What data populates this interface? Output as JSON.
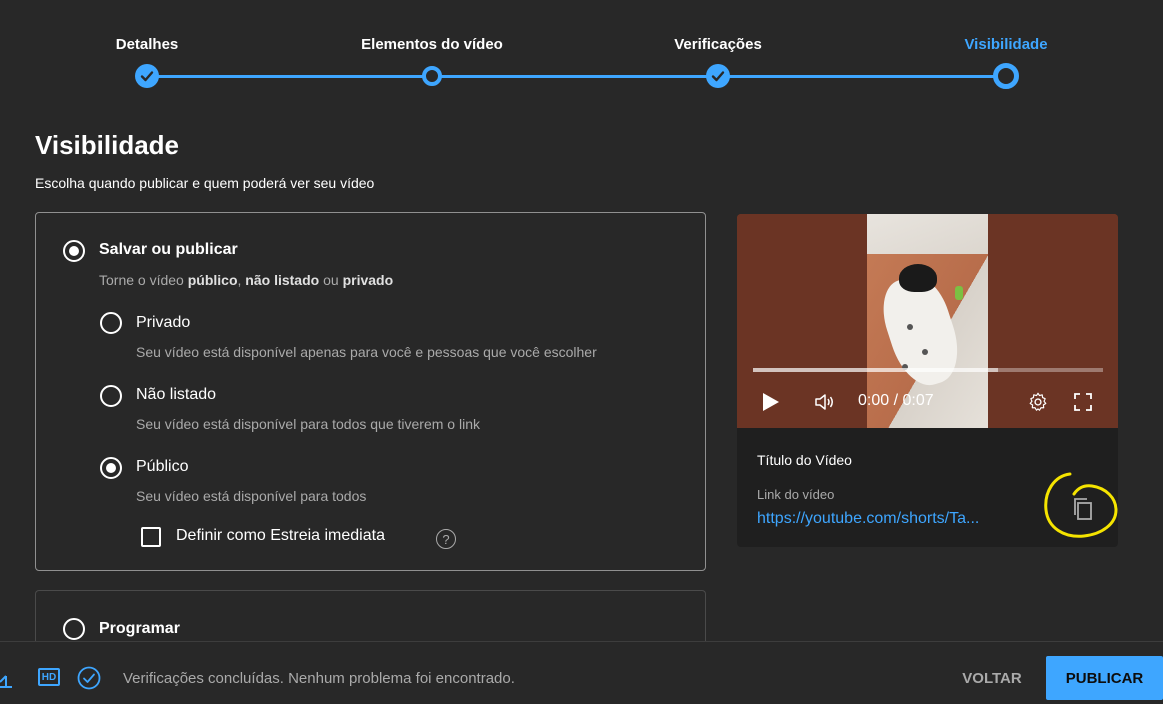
{
  "stepper": {
    "steps": [
      {
        "label": "Detalhes",
        "state": "done"
      },
      {
        "label": "Elementos do vídeo",
        "state": "done"
      },
      {
        "label": "Verificações",
        "state": "done"
      },
      {
        "label": "Visibilidade",
        "state": "current"
      }
    ]
  },
  "heading": {
    "title": "Visibilidade",
    "subtitle": "Escolha quando publicar e quem poderá ver seu vídeo"
  },
  "save_publish": {
    "title": "Salvar ou publicar",
    "desc_prefix": "Torne o vídeo ",
    "desc_public": "público",
    "desc_sep1": ", ",
    "desc_unlisted": "não listado",
    "desc_sep2": " ou ",
    "desc_private": "privado",
    "selected": true,
    "options": [
      {
        "title": "Privado",
        "desc": "Seu vídeo está disponível apenas para você e pessoas que você escolher",
        "selected": false
      },
      {
        "title": "Não listado",
        "desc": "Seu vídeo está disponível para todos que tiverem o link",
        "selected": false
      },
      {
        "title": "Público",
        "desc": "Seu vídeo está disponível para todos",
        "selected": true
      }
    ],
    "premiere": {
      "label": "Definir como Estreia imediata",
      "checked": false,
      "help": "?"
    }
  },
  "schedule": {
    "title": "Programar",
    "selected": false
  },
  "preview": {
    "time": "0:00 / 0:07",
    "progress_fraction": 0.7,
    "video_title": "Título do Vídeo",
    "link_label": "Link do vídeo",
    "link_url": "https://youtube.com/shorts/Ta..."
  },
  "footer": {
    "hd_label": "HD",
    "status": "Verificações concluídas. Nenhum problema foi encontrado.",
    "back_label": "VOLTAR",
    "publish_label": "PUBLICAR"
  },
  "colors": {
    "accent": "#3ea6ff",
    "background": "#282828",
    "annotation": "#f5e400"
  }
}
